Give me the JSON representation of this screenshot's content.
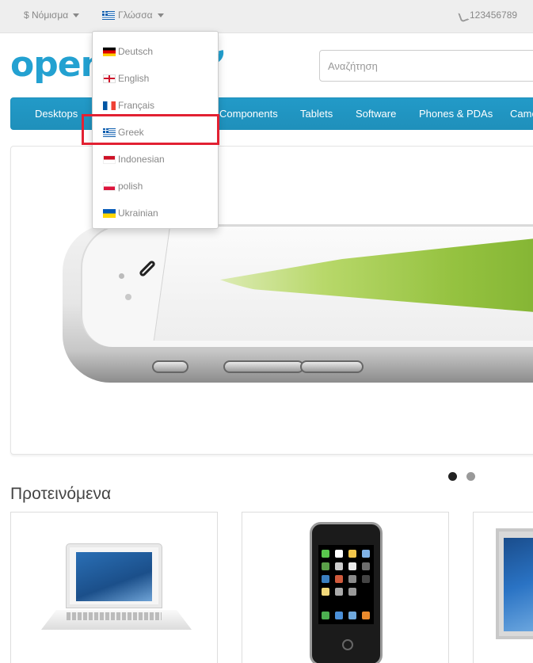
{
  "topbar": {
    "currency_label": "$ Νόμισμα",
    "language_label": "Γλώσσα",
    "phone": "123456789"
  },
  "logo": {
    "text": "open"
  },
  "search": {
    "placeholder": "Αναζήτηση"
  },
  "nav": {
    "items": [
      "Desktops",
      "Components",
      "Tablets",
      "Software",
      "Phones & PDAs",
      "Came"
    ]
  },
  "language_menu": {
    "items": [
      {
        "label": "Deutsch",
        "flag": "de-flag-icon"
      },
      {
        "label": "English",
        "flag": "en-flag-icon"
      },
      {
        "label": "Français",
        "flag": "fr-flag-icon"
      },
      {
        "label": "Greek",
        "flag": "gr-flag-icon",
        "highlighted": true
      },
      {
        "label": "Indonesian",
        "flag": "id-flag-icon"
      },
      {
        "label": "polish",
        "flag": "pl-flag-icon"
      },
      {
        "label": "Ukrainian",
        "flag": "ua-flag-icon"
      }
    ]
  },
  "slideshow": {
    "active_index": 0,
    "count": 2
  },
  "featured": {
    "title": "Προτεινόμενα"
  },
  "colors": {
    "brand": "#23a1d1",
    "nav_bg": "#229ac8",
    "highlight": "#e22132"
  }
}
